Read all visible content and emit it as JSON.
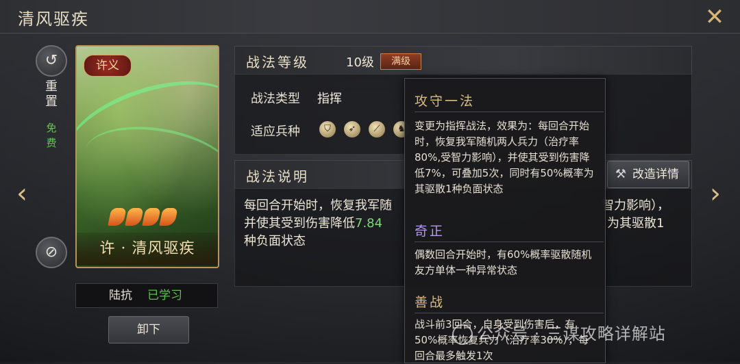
{
  "window": {
    "title": "清风驱疾",
    "close_icon": "close-icon"
  },
  "sidebar": {
    "reset_label_1": "重",
    "reset_label_2": "置",
    "free_label_1": "免",
    "free_label_2": "费"
  },
  "card": {
    "badge": "许义",
    "name": "许 · 清风驱疾",
    "stars": 4
  },
  "learner": {
    "name": "陆抗",
    "status": "已学习",
    "status_color": "#5ec04f"
  },
  "unload_button": "卸下",
  "tactic": {
    "level_header": "战法等级",
    "level_value": "10级",
    "level_badge": "满级",
    "type_label": "战法类型",
    "type_value": "指挥",
    "unit_label": "适应兵种",
    "units": [
      "shield-icon",
      "bow-icon",
      "spear-icon",
      "horse-icon"
    ],
    "desc_header": "战法说明",
    "desc_line1_a": "每回合开始时，恢复我军随",
    "desc_line1_b": "智力影响），",
    "desc_line2_a": "并使其受到伤害降低",
    "desc_line2_hl": "7.84",
    "desc_line2_b": "为其驱散1",
    "desc_line3": "种负面状态",
    "modify_button": "改造详情"
  },
  "tooltip": {
    "s1_title": "攻守一法",
    "s1_text": "变更为指挥战法，效果为：每回合开始时，恢复我军随机两人兵力（治疗率80%,受智力影响），并使其受到伤害降低7%，可叠加5次，同时有50%概率为其驱散1种负面状态",
    "s2_title": "奇正",
    "s2_text": "偶数回合开始时，有60%概率驱散随机友方单体一种异常状态",
    "s3_title": "善战",
    "s3_text": "战斗前3回合，自身受到伤害后，有50%概率恢复兵力（治疗率30%），每回合最多触发1次"
  },
  "watermark": "公众号 · 三谋攻略详解站",
  "colors": {
    "accent_gold": "#d9bb84",
    "highlight_green": "#7fd87a",
    "purple_title": "#b79be0"
  }
}
